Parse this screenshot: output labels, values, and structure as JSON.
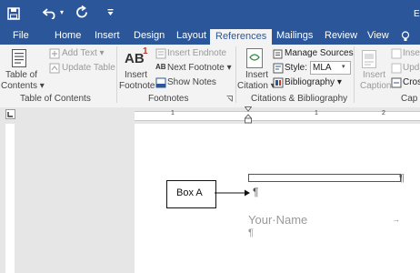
{
  "title_bar": {
    "save_icon": "save-icon",
    "undo_icon": "undo-icon",
    "undo_dropdown": "▾",
    "redo_icon": "redo-icon",
    "customize_icon": "customize-quick-access-icon",
    "edge_glyph": "E"
  },
  "tabs": {
    "file": "File",
    "home": "Home",
    "insert": "Insert",
    "design": "Design",
    "layout": "Layout",
    "references": "References",
    "mailings": "Mailings",
    "review": "Review",
    "view": "View",
    "tell_me_icon": "lightbulb-icon"
  },
  "ribbon": {
    "toc": {
      "table_of_contents_line1": "Table of",
      "table_of_contents_line2": "Contents ▾",
      "add_text": "Add Text ▾",
      "update_table": "Update Table",
      "group_label": "Table of Contents"
    },
    "footnotes": {
      "insert_footnote_line1": "Insert",
      "insert_footnote_line2": "Footnote",
      "ab_glyph": "AB",
      "ab_superscript": "1",
      "insert_endnote": "Insert Endnote",
      "next_footnote": "Next Footnote ▾",
      "show_notes": "Show Notes",
      "group_label": "Footnotes",
      "launcher_icon": "dialog-launcher-icon"
    },
    "citations": {
      "insert_citation_line1": "Insert",
      "insert_citation_line2": "Citation ▾",
      "manage_sources": "Manage Sources",
      "style_label": "Style:",
      "style_value": "MLA",
      "bibliography": "Bibliography ▾",
      "group_label": "Citations & Bibliography"
    },
    "captions": {
      "insert_caption_line1": "Insert",
      "insert_caption_line2": "Caption",
      "insert_table_of_figures": "Inser",
      "update_table": "Upda",
      "cross_reference": "Cros",
      "group_label": "Cap"
    }
  },
  "ruler": {
    "mark_1": "1",
    "mark_1b": "1",
    "mark_2": "2",
    "tab_selector_icon": "left-tab-icon"
  },
  "document": {
    "annotation_label": "Box A",
    "cursor_marks": "¶",
    "pilcrow_end": "¶",
    "your_name": "Your·Name",
    "tab_arrow": "→",
    "pilcrow_after_name": "¶"
  }
}
